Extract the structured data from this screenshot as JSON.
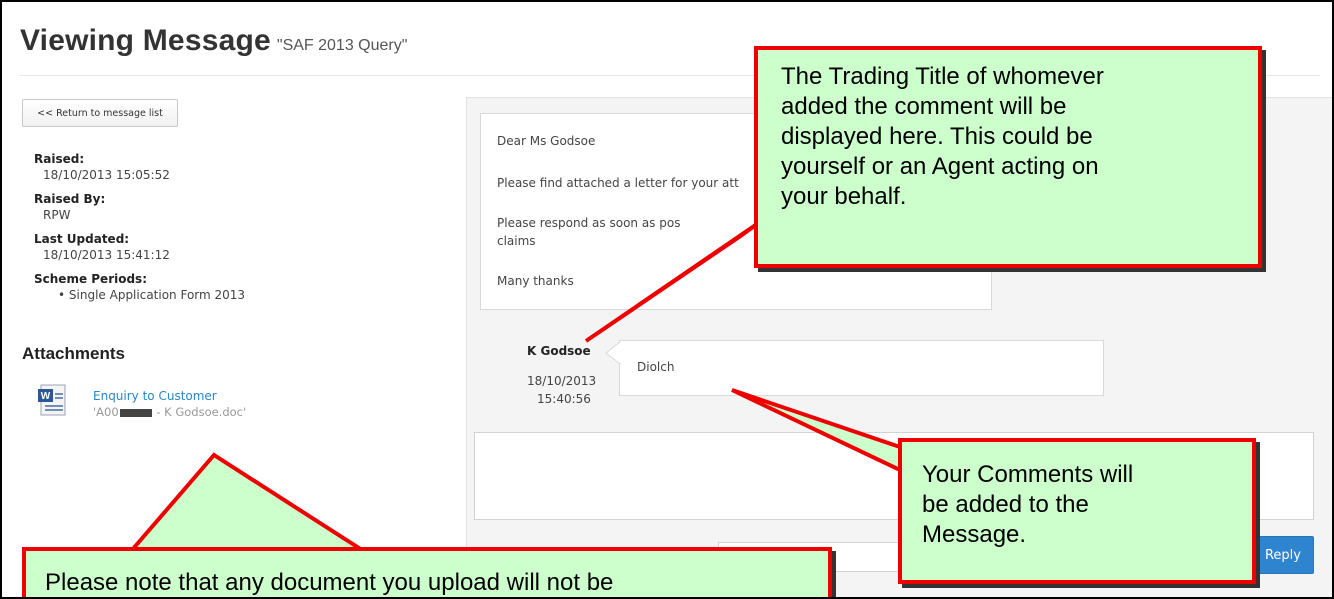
{
  "header": {
    "title": "Viewing Message",
    "subject": "\"SAF 2013 Query\""
  },
  "sidebar": {
    "return_label": "<< Return to message list",
    "raised_label": "Raised:",
    "raised_value": "18/10/2013 15:05:52",
    "raised_by_label": "Raised By:",
    "raised_by_value": "RPW",
    "last_updated_label": "Last Updated:",
    "last_updated_value": "18/10/2013 15:41:12",
    "scheme_periods_label": "Scheme Periods:",
    "scheme_periods": [
      "Single Application Form 2013"
    ]
  },
  "attachments": {
    "heading": "Attachments",
    "items": [
      {
        "name": "Enquiry to Customer",
        "file_prefix": "'A00",
        "file_suffix": " - K Godsoe.doc'",
        "icon": "word-document-icon"
      }
    ]
  },
  "message": {
    "lines": [
      "Dear Ms Godsoe",
      "Please find attached a letter for your att",
      "Please respond as soon as pos",
      "claims",
      "Many thanks"
    ]
  },
  "comment": {
    "author": "K Godsoe",
    "date": "18/10/2013",
    "time": "15:40:56",
    "text": "Diolch"
  },
  "reply": {
    "input_value": "",
    "button_label": "Reply"
  },
  "callouts": {
    "top": [
      "The Trading Title of whomever",
      "added the comment will be",
      "displayed here.  This could be",
      "yourself or an Agent acting on",
      "your behalf."
    ],
    "right": [
      "Your Comments will",
      "be added to the",
      "Message."
    ],
    "bottom": [
      "Please note that any document you upload will not be"
    ]
  },
  "colors": {
    "callout_fill": "#ccffcc",
    "callout_border": "#ee0000",
    "link": "#2a86c8",
    "reply_button": "#2f84cf"
  }
}
